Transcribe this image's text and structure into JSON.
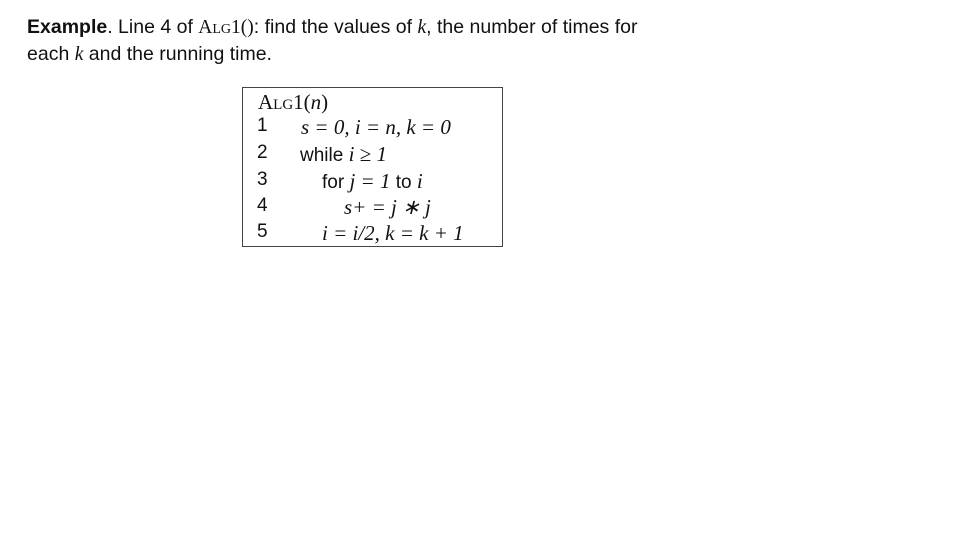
{
  "intro": {
    "bold": "Example",
    "part1": ". Line 4 of ",
    "alg_name": "Alg1",
    "alg_parens": "()",
    "part2": ": find the values of ",
    "var_k": "k",
    "part3": ", the number of times for",
    "part4": "each ",
    "var_k2": "k",
    "part5": " and the running time."
  },
  "algorithm": {
    "title_name": "Alg1",
    "title_open": "(",
    "title_arg": "n",
    "title_close": ")",
    "lines": [
      {
        "number": "1",
        "keyword": "",
        "math": "s = 0, i = n, k = 0",
        "tail_kw": "",
        "tail_math": ""
      },
      {
        "number": "2",
        "keyword": "while ",
        "math": "i ≥ 1",
        "tail_kw": "",
        "tail_math": ""
      },
      {
        "number": "3",
        "keyword": "for ",
        "math": "j = 1",
        "tail_kw": " to ",
        "tail_math": "i"
      },
      {
        "number": "4",
        "keyword": "",
        "math": "s+ = j ∗ j",
        "tail_kw": "",
        "tail_math": ""
      },
      {
        "number": "5",
        "keyword": "",
        "math": "i = i/2, k = k + 1",
        "tail_kw": "",
        "tail_math": ""
      }
    ]
  }
}
